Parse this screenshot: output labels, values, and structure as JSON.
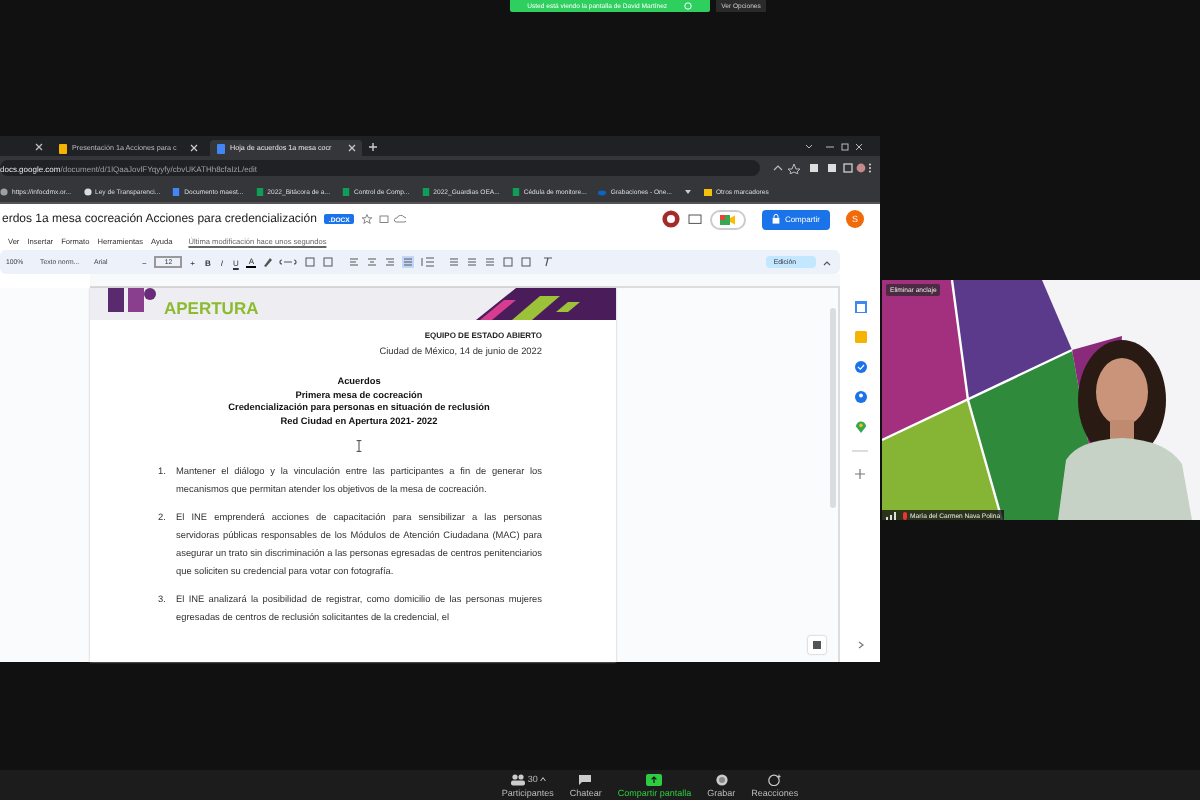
{
  "share_banner": {
    "text": "Usted está viendo la pantalla de David Martínez",
    "options": "Ver Opciones"
  },
  "browser": {
    "tabs": [
      {
        "label": "Presentación 1a Acciones para c",
        "kind": "slides",
        "selected": false
      },
      {
        "label": "Hoja de acuerdos 1a mesa cocr",
        "kind": "docs",
        "selected": true
      }
    ],
    "address": {
      "domain": "docs.google.com",
      "path": "/document/d/1lQaaJovlFYqyyfy/cbvUKATHh8cfaIzL/edit"
    },
    "bookmarks": [
      {
        "label": "https://infocdmx.or...",
        "kind": "link"
      },
      {
        "label": "Ley de Transparenci...",
        "kind": "globe"
      },
      {
        "label": "Documento maest...",
        "kind": "docs"
      },
      {
        "label": "2022_Bitácora de a...",
        "kind": "sheets"
      },
      {
        "label": "Control de Comp...",
        "kind": "sheets"
      },
      {
        "label": "2022_Guardias OEA...",
        "kind": "sheets"
      },
      {
        "label": "Cédula de monitore...",
        "kind": "sheets"
      },
      {
        "label": "Grabaciones - One...",
        "kind": "cloud"
      }
    ],
    "other_bookmarks": "Otros marcadores"
  },
  "docs": {
    "title": "erdos 1a mesa cocreación Acciones para credencialización",
    "badge": ".DOCX",
    "share": "Compartir",
    "avatar": "S",
    "menu": [
      "Ver",
      "Insertar",
      "Formato",
      "Herramientas",
      "Ayuda"
    ],
    "last_edit": "Última modificación hace unos segundos",
    "toolbar": {
      "zoom": "100%",
      "style": "Texto norm...",
      "font": "Arial",
      "size_down": "−",
      "size": "12",
      "size_up": "+",
      "format": [
        "B",
        "I",
        "U",
        "A"
      ],
      "mode": "Edición"
    }
  },
  "document": {
    "logo": "APERTURA",
    "team": "EQUIPO DE ESTADO ABIERTO",
    "place_date": "Ciudad de México, 14 de junio de 2022",
    "headings": [
      "Acuerdos",
      "Primera mesa de cocreación",
      "Credencialización para personas en situación de reclusión",
      "Red Ciudad en Apertura 2021- 2022"
    ],
    "items": [
      {
        "number": "1.",
        "text": "Mantener el diálogo y la vinculación entre las participantes a fin de generar los mecanismos que permitan atender los objetivos de la mesa de cocreación."
      },
      {
        "number": "2.",
        "text": "El INE emprenderá acciones de capacitación para sensibilizar a las personas servidoras públicas responsables de los Módulos de Atención Ciudadana (MAC) para asegurar un trato sin discriminación a las personas egresadas de centros penitenciarios que soliciten su credencial para votar con fotografía."
      },
      {
        "number": "3.",
        "text": "El INE analizará la posibilidad de registrar, como domicilio de las personas mujeres egresadas de centros de reclusión solicitantes de la credencial, el"
      }
    ]
  },
  "video": {
    "unpin": "Eliminar anclaje",
    "name": "María del Carmen Nava Polina"
  },
  "meeting_controls": [
    {
      "label": "Participantes",
      "count": "30",
      "kind": "participants",
      "active": false
    },
    {
      "label": "Chatear",
      "kind": "chat",
      "active": false
    },
    {
      "label": "Compartir pantalla",
      "kind": "share",
      "active": true
    },
    {
      "label": "Grabar",
      "kind": "record",
      "active": false
    },
    {
      "label": "Reacciones",
      "kind": "reactions",
      "active": false
    }
  ]
}
